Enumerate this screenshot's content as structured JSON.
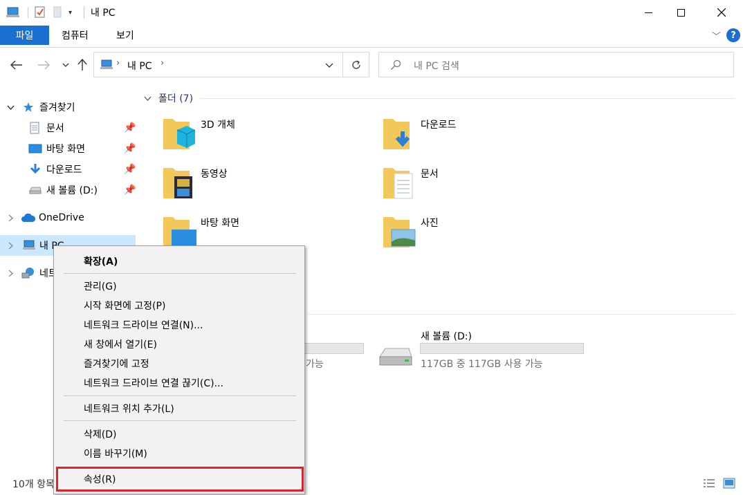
{
  "window": {
    "title": "내 PC",
    "controls": {
      "minimize": "—",
      "maximize": "☐",
      "close": "✕"
    }
  },
  "ribbon": {
    "tabs": [
      "파일",
      "컴퓨터",
      "보기"
    ],
    "help": "?"
  },
  "address": {
    "path": [
      "내 PC"
    ],
    "search_placeholder": "내 PC 검색"
  },
  "nav": {
    "quick_access": "즐겨찾기",
    "pinned": [
      {
        "label": "문서",
        "icon": "document-icon"
      },
      {
        "label": "바탕 화면",
        "icon": "desktop-icon"
      },
      {
        "label": "다운로드",
        "icon": "download-icon"
      },
      {
        "label": "새 볼륨 (D:)",
        "icon": "drive-icon"
      }
    ],
    "onedrive": "OneDrive",
    "this_pc": "내 PC",
    "network": "네트"
  },
  "content": {
    "folders_group": "폴더 (7)",
    "folders": [
      {
        "label": "3D 개체",
        "icon": "3d-objects-icon"
      },
      {
        "label": "다운로드",
        "icon": "downloads-folder-icon"
      },
      {
        "label": "동영상",
        "icon": "videos-folder-icon"
      },
      {
        "label": "문서",
        "icon": "documents-folder-icon"
      },
      {
        "label": "바탕 화면",
        "icon": "desktop-folder-icon"
      },
      {
        "label": "사진",
        "icon": "pictures-folder-icon"
      }
    ],
    "drives": [
      {
        "label": "",
        "free_text": "가능",
        "used_fraction": 0.0
      },
      {
        "label": "새 볼륨 (D:)",
        "free_text": "117GB 중 117GB 사용 가능",
        "used_fraction": 0.0
      }
    ]
  },
  "context_menu": {
    "items": [
      {
        "label": "확장(A)",
        "bold": true
      },
      {
        "label": "관리(G)"
      },
      {
        "label": "시작 화면에 고정(P)"
      },
      {
        "label": "네트워크 드라이브 연결(N)..."
      },
      {
        "label": "새 창에서 열기(E)"
      },
      {
        "label": "즐겨찾기에 고정"
      },
      {
        "label": "네트워크 드라이브 연결 끊기(C)..."
      },
      {
        "label": "네트워크 위치 추가(L)"
      },
      {
        "label": "삭제(D)"
      },
      {
        "label": "이름 바꾸기(M)"
      },
      {
        "label": "속성(R)"
      }
    ],
    "highlight_color": "#e0202a"
  },
  "status": {
    "item_count": "10개 항목"
  },
  "colors": {
    "accent": "#1a6fd0",
    "selection": "#cce8ff",
    "group_heading": "#1e3287"
  }
}
